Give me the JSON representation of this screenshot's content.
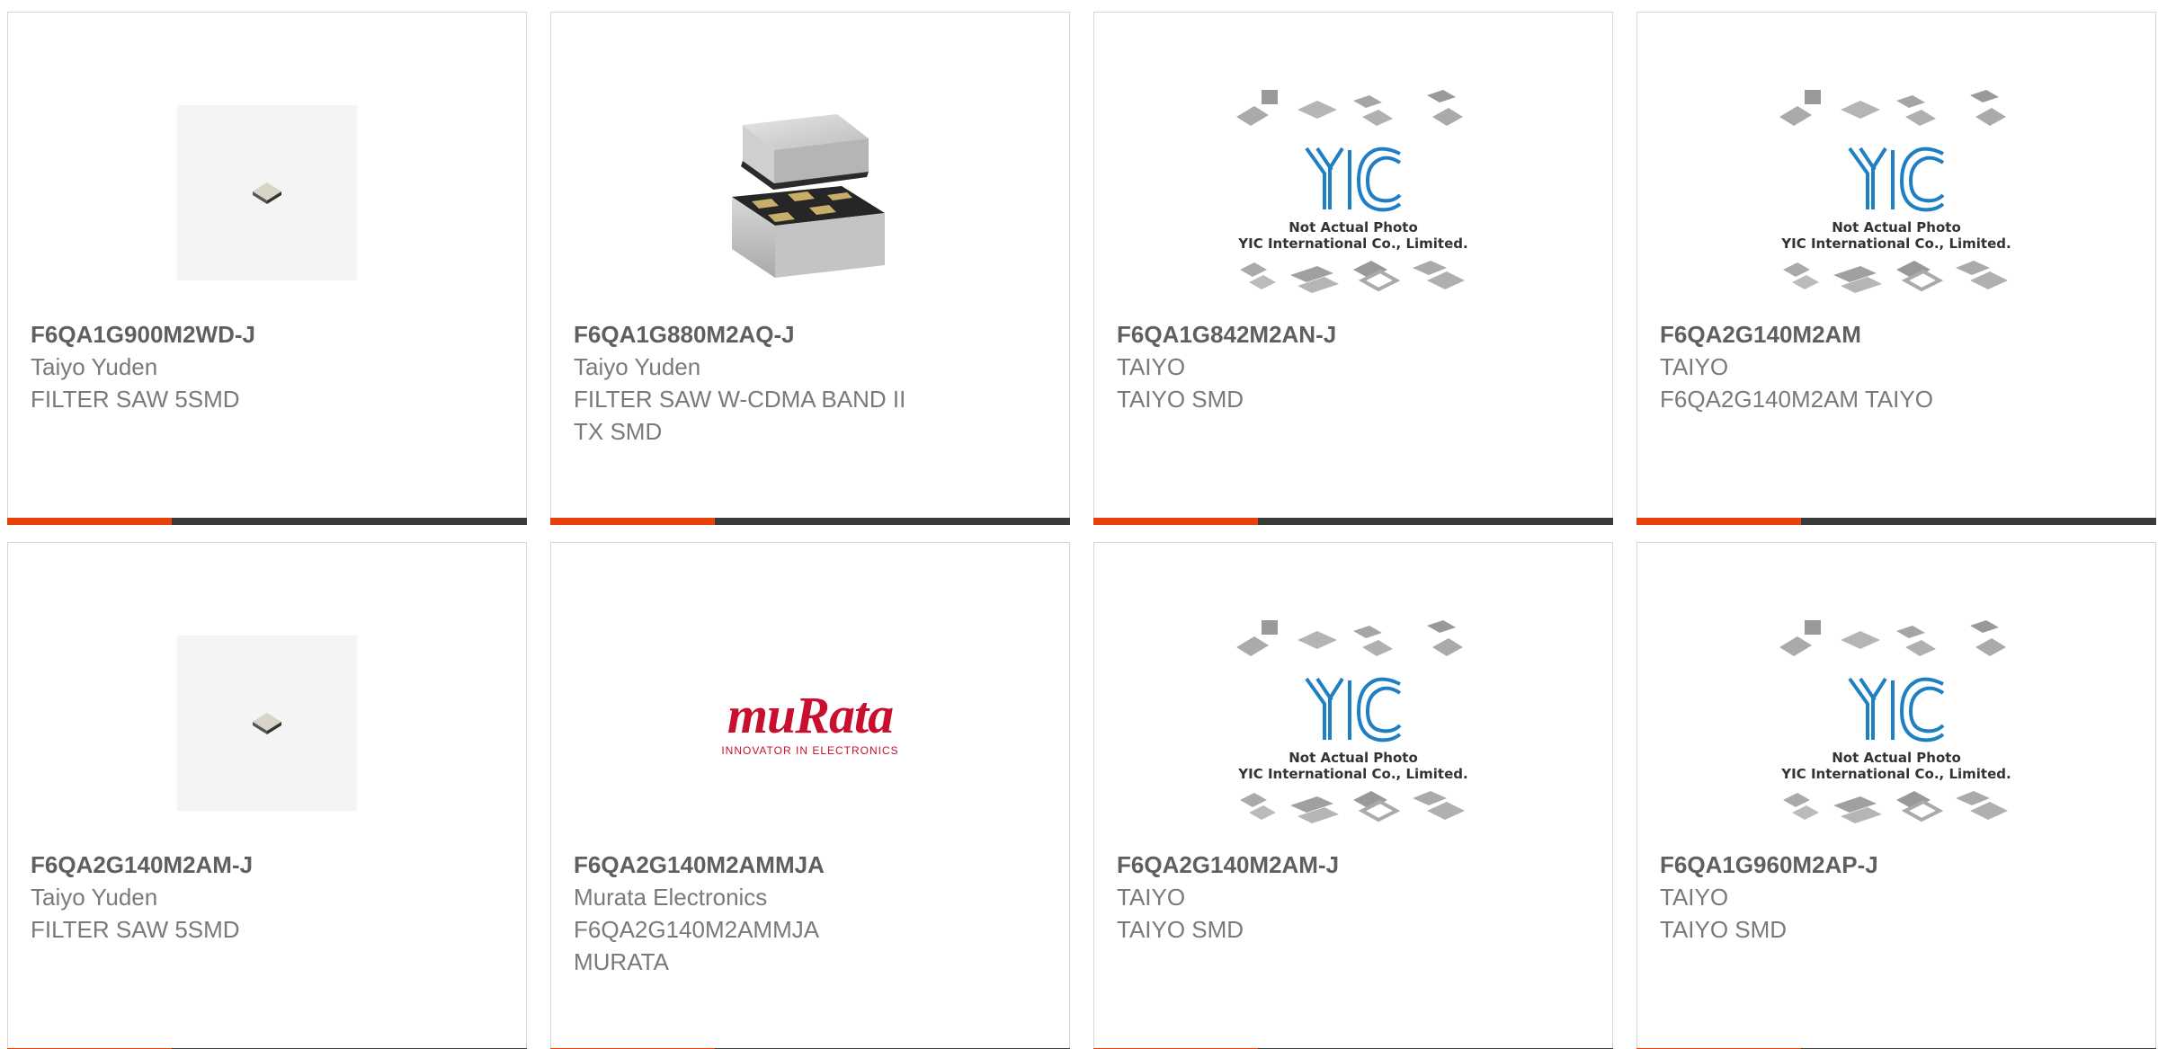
{
  "products": [
    {
      "part": "F6QA1G900M2WD-J",
      "maker": "Taiyo Yuden",
      "desc": "FILTER SAW 5SMD",
      "desc2": "",
      "image": "chip-photo"
    },
    {
      "part": "F6QA1G880M2AQ-J",
      "maker": "Taiyo Yuden",
      "desc": "FILTER SAW W-CDMA BAND II",
      "desc2": "TX SMD",
      "image": "saw-package-photo"
    },
    {
      "part": "F6QA1G842M2AN-J",
      "maker": "TAIYO",
      "desc": "TAIYO SMD",
      "desc2": "",
      "image": "yic-placeholder"
    },
    {
      "part": "F6QA2G140M2AM",
      "maker": "TAIYO",
      "desc": "F6QA2G140M2AM TAIYO",
      "desc2": "",
      "image": "yic-placeholder"
    },
    {
      "part": "F6QA2G140M2AM-J",
      "maker": "Taiyo Yuden",
      "desc": "FILTER SAW 5SMD",
      "desc2": "",
      "image": "chip-photo"
    },
    {
      "part": "F6QA2G140M2AMMJA",
      "maker": "Murata Electronics",
      "desc": "F6QA2G140M2AMMJA",
      "desc2": "MURATA",
      "image": "murata-logo"
    },
    {
      "part": "F6QA2G140M2AM-J",
      "maker": "TAIYO",
      "desc": "TAIYO SMD",
      "desc2": "",
      "image": "yic-placeholder"
    },
    {
      "part": "F6QA1G960M2AP-J",
      "maker": "TAIYO",
      "desc": "TAIYO SMD",
      "desc2": "",
      "image": "yic-placeholder"
    }
  ],
  "placeholder": {
    "line1": "Not Actual Photo",
    "line2": "YIC International Co., Limited."
  },
  "murata_logo": {
    "brand": "muRata",
    "tagline": "INNOVATOR IN ELECTRONICS"
  },
  "colors": {
    "accent": "#e8410a",
    "bar": "#3a3a3a",
    "yic_blue": "#1f7fc4",
    "murata_red": "#c8102e"
  }
}
